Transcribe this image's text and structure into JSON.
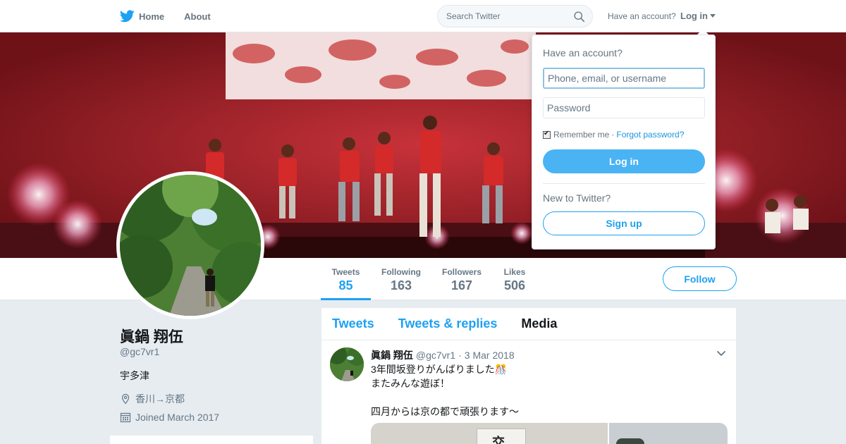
{
  "nav": {
    "home_label": "Home",
    "about_label": "About",
    "search_placeholder": "Search Twitter",
    "have_account": "Have an account?",
    "login_label": "Log in"
  },
  "profile": {
    "name": "眞鍋 翔伍",
    "handle": "@gc7vr1",
    "bio": "宇多津",
    "location": "香川→京都",
    "joined": "Joined March 2017"
  },
  "stats": [
    {
      "label": "Tweets",
      "value": "85"
    },
    {
      "label": "Following",
      "value": "163"
    },
    {
      "label": "Followers",
      "value": "167"
    },
    {
      "label": "Likes",
      "value": "506"
    }
  ],
  "follow_label": "Follow",
  "tabs": [
    {
      "label": "Tweets"
    },
    {
      "label": "Tweets & replies"
    },
    {
      "label": "Media"
    }
  ],
  "tweet": {
    "name": "眞鍋 翔伍",
    "handle": "@gc7vr1",
    "separator": "·",
    "date": "3 Mar 2018",
    "lines": [
      "3年間坂登りがんばりました🎊",
      "またみんな遊ぼ！",
      "",
      "四月からは京の都で頑張ります〜"
    ]
  },
  "login_dropdown": {
    "title": "Have an account?",
    "username_placeholder": "Phone, email, or username",
    "password_placeholder": "Password",
    "remember_me": "Remember me",
    "separator": "·",
    "forgot_password": "Forgot password?",
    "login_button": "Log in",
    "new_to_twitter": "New to Twitter?",
    "signup_button": "Sign up"
  },
  "colors": {
    "accent": "#1da1f2",
    "login_button": "#4ab3f4",
    "page_bg": "#e6ecf0"
  },
  "icons": [
    "twitter-bird-icon",
    "search-icon",
    "caret-down-icon",
    "location-pin-icon",
    "calendar-icon",
    "chevron-down-icon"
  ]
}
